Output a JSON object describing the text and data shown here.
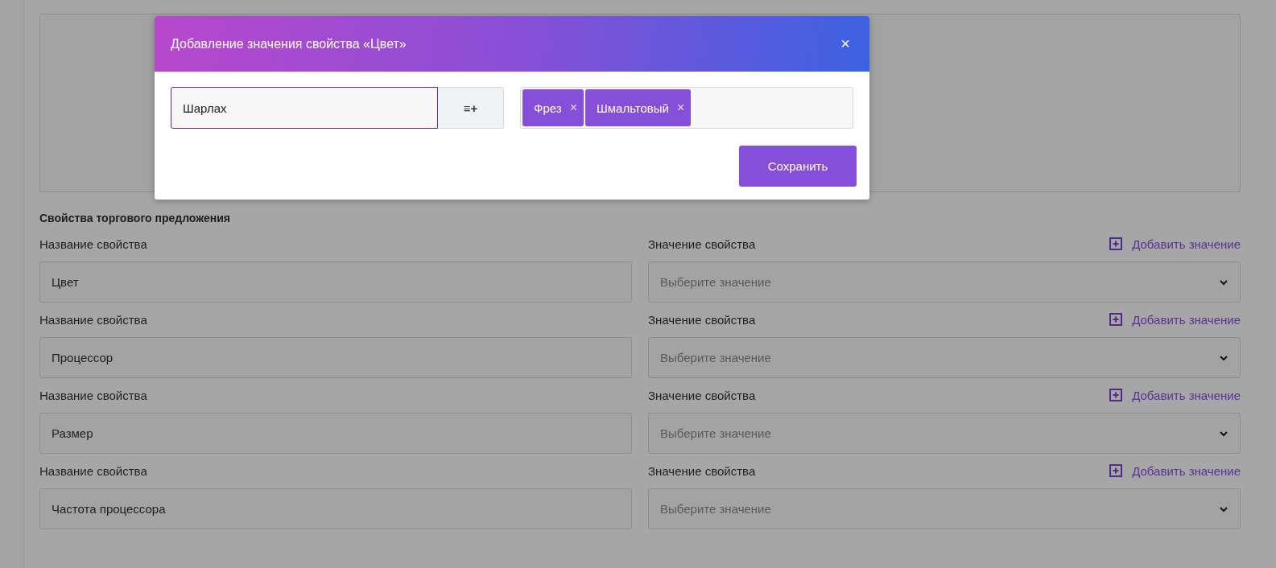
{
  "section_title": "Свойства торгового предложения",
  "properties": [
    {
      "name_label": "Название свойства",
      "name_value": "Цвет",
      "value_label": "Значение свойства",
      "add_link": "Добавить значение",
      "value_placeholder": "Выберите значение"
    },
    {
      "name_label": "Название свойства",
      "name_value": "Процессор",
      "value_label": "Значение свойства",
      "add_link": "Добавить значение",
      "value_placeholder": "Выберите значение"
    },
    {
      "name_label": "Название свойства",
      "name_value": "Размер",
      "value_label": "Значение свойства",
      "add_link": "Добавить значение",
      "value_placeholder": "Выберите значение"
    },
    {
      "name_label": "Название свойства",
      "name_value": "Частота процессора",
      "value_label": "Значение свойства",
      "add_link": "Добавить значение",
      "value_placeholder": "Выберите значение"
    }
  ],
  "modal": {
    "title": "Добавление значения свойства «Цвет»",
    "close": "×",
    "input_value": "Шарлах",
    "add_button": "≡+",
    "tags": [
      {
        "label": "Фрез",
        "remove": "×"
      },
      {
        "label": "Шмальтовый",
        "remove": "×"
      }
    ],
    "save_button": "Сохранить"
  }
}
